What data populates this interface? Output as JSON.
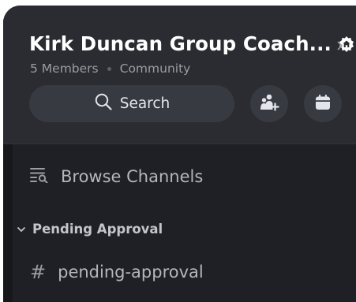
{
  "server": {
    "name": "Kirk Duncan Group Coach...",
    "members": "5 Members",
    "type": "Community"
  },
  "actions": {
    "search_label": "Search",
    "invite_icon": "add-member-icon",
    "events_icon": "calendar-icon"
  },
  "browse": {
    "label": "Browse Channels",
    "icon": "browse-channels-icon"
  },
  "category": {
    "label": "Pending Approval",
    "collapsed": false
  },
  "channels": [
    {
      "prefix": "#",
      "name": "pending-approval"
    }
  ],
  "colors": {
    "panel": "#1f2025",
    "header": "#2a2c31",
    "button": "#383a42",
    "text_primary": "#ffffff",
    "text_muted": "#9a9ca6"
  }
}
